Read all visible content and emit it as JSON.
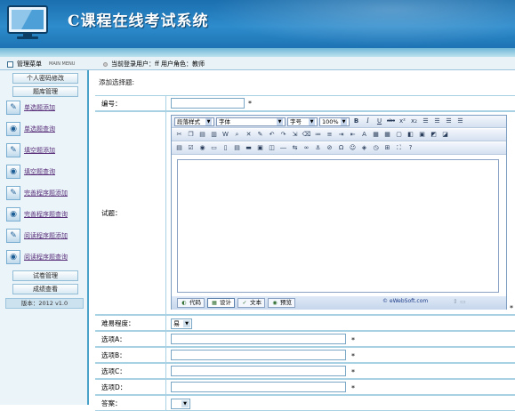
{
  "app": {
    "title": "C课程在线考试系统"
  },
  "infobar": {
    "menu_label": "管理菜单",
    "menu_sub": "MAIN MENU",
    "user_text": "当前登录用户：ff   用户角色：教师"
  },
  "sidebar": {
    "items": [
      {
        "type": "button",
        "label": "个人密码修改"
      },
      {
        "type": "button",
        "label": "题库管理"
      },
      {
        "type": "link",
        "label": "单选题添加",
        "icon": "document-icon"
      },
      {
        "type": "link",
        "label": "单选题查询",
        "icon": "globe-icon"
      },
      {
        "type": "link",
        "label": "填空题添加",
        "icon": "document-icon"
      },
      {
        "type": "link",
        "label": "填空题查询",
        "icon": "globe-icon"
      },
      {
        "type": "link",
        "label": "完善程序题添加",
        "icon": "document-icon"
      },
      {
        "type": "link",
        "label": "完善程序题查询",
        "icon": "globe-icon"
      },
      {
        "type": "link",
        "label": "阅读程序题添加",
        "icon": "document-icon"
      },
      {
        "type": "link",
        "label": "阅读程序题查询",
        "icon": "globe-icon"
      },
      {
        "type": "button",
        "label": "试卷管理"
      },
      {
        "type": "button",
        "label": "成绩查看"
      }
    ],
    "version": "版本：2012 v1.0"
  },
  "form": {
    "title": "添加选择题:",
    "fields": {
      "number_label": "编号：",
      "question_label": "试题：",
      "difficulty_label": "难易程度：",
      "difficulty_value": "易",
      "option_a_label": "选项A：",
      "option_b_label": "选项B：",
      "option_c_label": "选项C：",
      "option_d_label": "选项D：",
      "answer_label": "答案："
    },
    "required_mark": "*"
  },
  "editor": {
    "paragraph_style": "段落样式",
    "font": "字体",
    "font_size": "字号",
    "zoom": "100%",
    "modes": [
      "代码",
      "设计",
      "文本",
      "预览"
    ],
    "copyright": "© eWebSoft.com"
  },
  "colors": {
    "header": "#1b6fae",
    "sidebar_bg": "#eaf4f9",
    "border": "#a8d1e4",
    "link": "#5a2f7a"
  }
}
